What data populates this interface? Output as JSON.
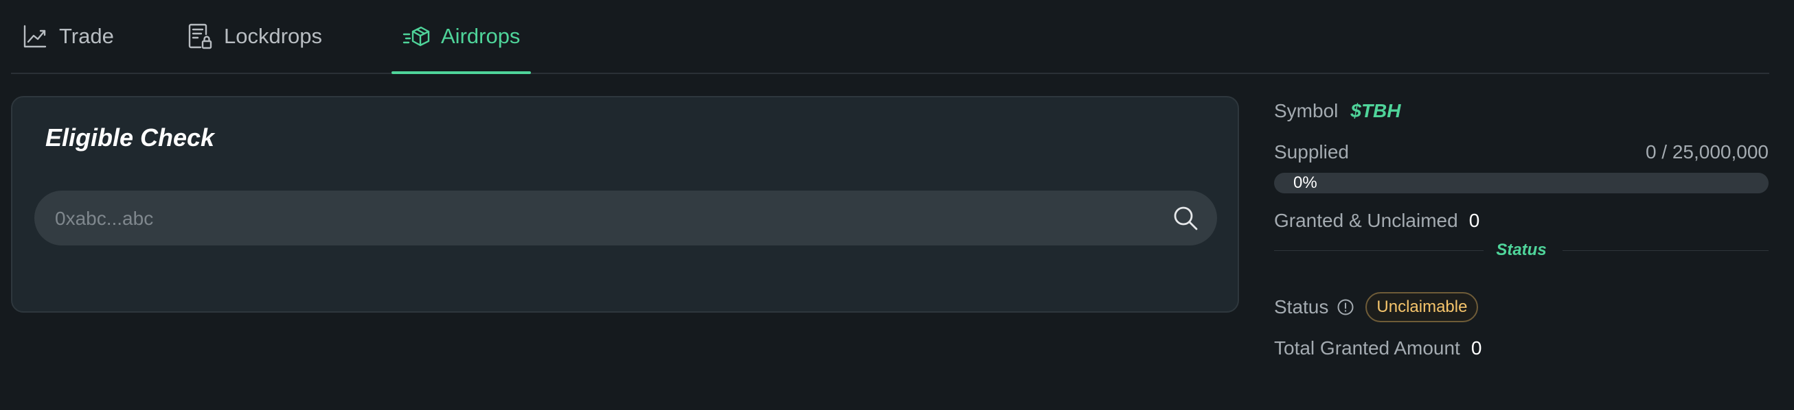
{
  "tabs": [
    {
      "label": "Trade",
      "icon": "chart-line-icon",
      "active": false
    },
    {
      "label": "Lockdrops",
      "icon": "lock-document-icon",
      "active": false
    },
    {
      "label": "Airdrops",
      "icon": "airdrop-box-icon",
      "active": true
    }
  ],
  "eligible": {
    "title": "Eligible Check",
    "search_placeholder": "0xabc...abc",
    "search_value": ""
  },
  "info": {
    "symbol_label": "Symbol",
    "symbol_value": "$TBH",
    "supplied_label": "Supplied",
    "supplied_value": "0 / 25,000,000",
    "progress_text": "0%",
    "progress_fraction": 0,
    "granted_label": "Granted & Unclaimed",
    "granted_value": "0",
    "status_section_label": "Status",
    "status_label": "Status",
    "status_badge": "Unclaimable",
    "total_label": "Total Granted Amount",
    "total_value": "0"
  },
  "colors": {
    "accent": "#4fd49a",
    "background": "#151a1e",
    "card": "#1f282e",
    "badge_text": "#f5c46b"
  }
}
